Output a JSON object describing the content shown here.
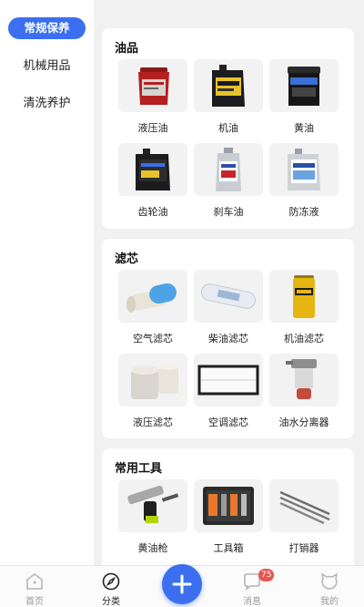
{
  "sidebar": {
    "items": [
      {
        "label": "常规保养",
        "active": true
      },
      {
        "label": "机械用品",
        "active": false
      },
      {
        "label": "清洗养护",
        "active": false
      }
    ]
  },
  "sections": [
    {
      "title": "油品",
      "products": [
        {
          "name": "液压油",
          "icon": "red-bucket"
        },
        {
          "name": "机油",
          "icon": "black-oil-jug"
        },
        {
          "name": "黄油",
          "icon": "grease-tub"
        },
        {
          "name": "齿轮油",
          "icon": "black-oil-jug"
        },
        {
          "name": "刹车油",
          "icon": "mobil-bottle"
        },
        {
          "name": "防冻液",
          "icon": "mobil-antifreeze-jug"
        }
      ]
    },
    {
      "title": "滤芯",
      "products": [
        {
          "name": "空气滤芯",
          "icon": "air-filter"
        },
        {
          "name": "柴油滤芯",
          "icon": "diesel-filter"
        },
        {
          "name": "机油滤芯",
          "icon": "cat-oil-filter"
        },
        {
          "name": "液压滤芯",
          "icon": "hydraulic-filter"
        },
        {
          "name": "空调滤芯",
          "icon": "ac-filter"
        },
        {
          "name": "油水分离器",
          "icon": "fuel-water-separator"
        }
      ]
    },
    {
      "title": "常用工具",
      "products": [
        {
          "name": "黄油枪",
          "icon": "grease-gun"
        },
        {
          "name": "工具箱",
          "icon": "toolbox"
        },
        {
          "name": "打销器",
          "icon": "pin-punch"
        }
      ]
    }
  ],
  "tabbar": {
    "tabs": [
      {
        "label": "首页",
        "icon": "home-icon",
        "active": false
      },
      {
        "label": "分类",
        "icon": "compass-icon",
        "active": true
      },
      {
        "label": "",
        "icon": "plus-icon",
        "active": false
      },
      {
        "label": "消息",
        "icon": "chat-icon",
        "active": false
      },
      {
        "label": "我的",
        "icon": "profile-icon",
        "active": false
      }
    ],
    "message_badge": "75"
  },
  "colors": {
    "accent": "#3b6ff0",
    "badge": "#e8544e"
  }
}
